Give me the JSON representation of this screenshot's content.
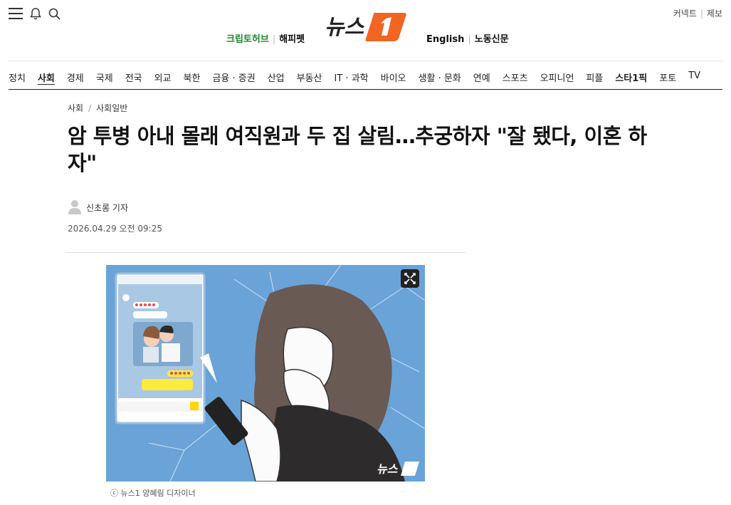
{
  "header": {
    "sub_left": [
      "크립토허브",
      "해피펫"
    ],
    "sub_right": [
      "English",
      "노동신문"
    ],
    "util_links": [
      "커넥트",
      "제보"
    ],
    "logo_text": "뉴스"
  },
  "nav": {
    "items": [
      "정치",
      "사회",
      "경제",
      "국제",
      "전국",
      "외교",
      "북한",
      "금융 · 증권",
      "산업",
      "부동산",
      "IT · 과학",
      "바이오",
      "생활 · 문화",
      "연예",
      "스포츠",
      "오피니언",
      "피플",
      "스타1픽",
      "포토",
      "TV"
    ],
    "active": "사회"
  },
  "article": {
    "breadcrumb": [
      "사회",
      "사회일반"
    ],
    "headline": "암 투병 아내 몰래 여직원과 두 집 살림…추궁하자 \"잘 됐다, 이혼 하자\"",
    "author": "신초롱 기자",
    "date": "2026.04.29 오전 09:25",
    "photo_caption": "ⓒ 뉴스1 양혜림 디자이너",
    "watermark": "뉴스"
  },
  "colors": {
    "brand_orange": "#f26522",
    "green": "#1e8a2e",
    "photo_bg": "#6aa3d8"
  }
}
